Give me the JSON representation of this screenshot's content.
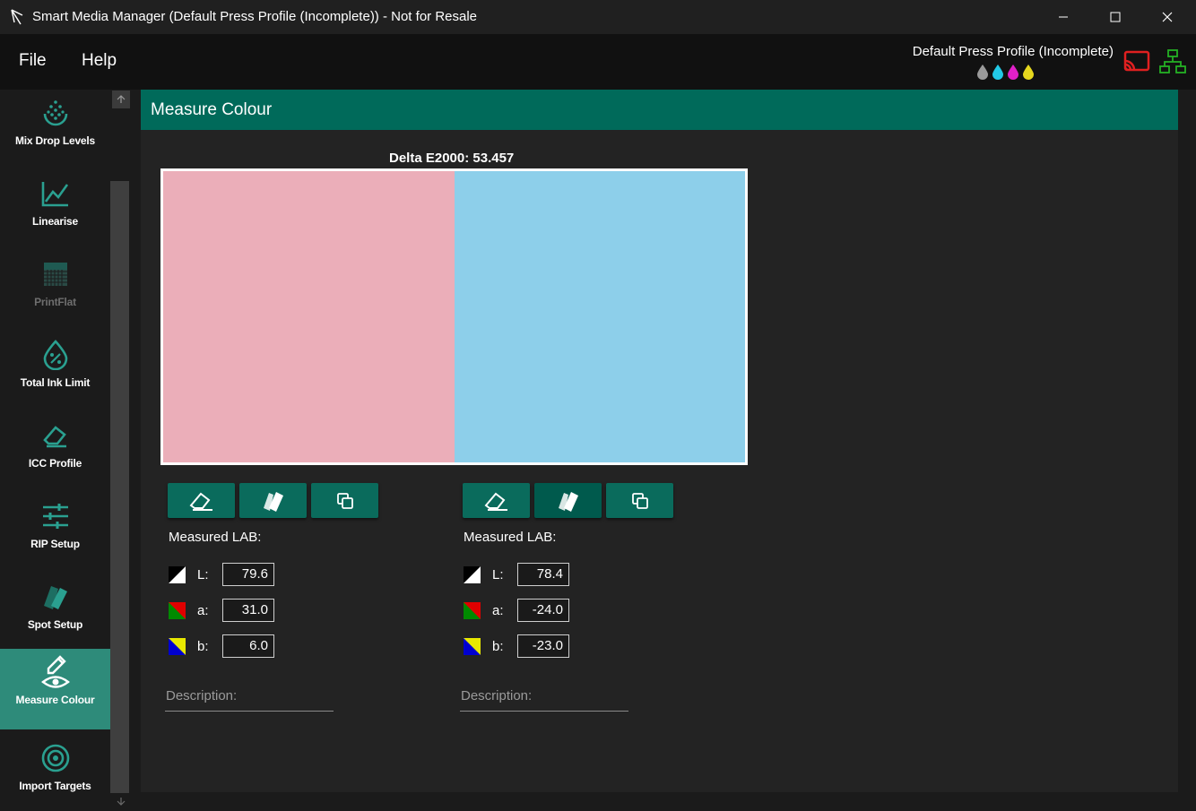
{
  "window": {
    "title": "Smart Media Manager (Default Press Profile (Incomplete)) - Not for Resale"
  },
  "menu": {
    "file": "File",
    "help": "Help"
  },
  "profile": {
    "name": "Default Press Profile (Incomplete)",
    "inks": [
      {
        "icon": "ink-drop-icon",
        "color": "#9a9a9a"
      },
      {
        "icon": "ink-drop-icon",
        "color": "#22c9e6"
      },
      {
        "icon": "ink-drop-icon",
        "color": "#e020c8"
      },
      {
        "icon": "ink-drop-icon",
        "color": "#e6d81e"
      }
    ],
    "cast_icon_color": "#e02020",
    "network_icon_color": "#24b024"
  },
  "sidebar": {
    "items": [
      {
        "label": "Mix Drop Levels",
        "icon": "drops-icon",
        "state": "normal"
      },
      {
        "label": "Linearise",
        "icon": "chart-line-icon",
        "state": "normal"
      },
      {
        "label": "PrintFlat",
        "icon": "grid-pattern-icon",
        "state": "disabled"
      },
      {
        "label": "Total Ink Limit",
        "icon": "ink-percent-icon",
        "state": "normal"
      },
      {
        "label": "ICC Profile",
        "icon": "eraser-icon",
        "state": "normal"
      },
      {
        "label": "RIP Setup",
        "icon": "sliders-icon",
        "state": "normal"
      },
      {
        "label": "Spot Setup",
        "icon": "swatch-book-icon",
        "state": "normal"
      },
      {
        "label": "Measure Colour",
        "icon": "eyedropper-eye-icon",
        "state": "active"
      },
      {
        "label": "Import Targets",
        "icon": "target-icon",
        "state": "normal"
      }
    ]
  },
  "main": {
    "title": "Measure Colour",
    "delta_e": "Delta E2000: 53.457",
    "swatches": {
      "left": "#ebaeb9",
      "right": "#8dcfea"
    },
    "accent": "#006a5a",
    "left_panel": {
      "measured_label": "Measured LAB:",
      "L_label": "L:",
      "a_label": "a:",
      "b_label": "b:",
      "L": "79.6",
      "a": "31.0",
      "b": "6.0",
      "description_placeholder": "Description:"
    },
    "right_panel": {
      "measured_label": "Measured LAB:",
      "L_label": "L:",
      "a_label": "a:",
      "b_label": "b:",
      "L": "78.4",
      "a": "-24.0",
      "b": "-23.0",
      "description_placeholder": "Description:"
    }
  }
}
